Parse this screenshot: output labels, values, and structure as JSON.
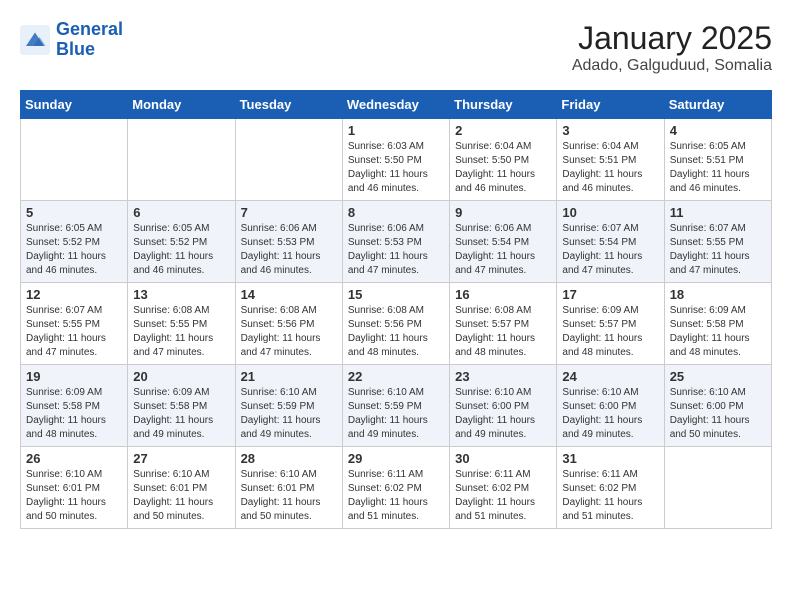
{
  "header": {
    "logo_line1": "General",
    "logo_line2": "Blue",
    "title": "January 2025",
    "subtitle": "Adado, Galguduud, Somalia"
  },
  "weekdays": [
    "Sunday",
    "Monday",
    "Tuesday",
    "Wednesday",
    "Thursday",
    "Friday",
    "Saturday"
  ],
  "weeks": [
    [
      {
        "day": "",
        "info": ""
      },
      {
        "day": "",
        "info": ""
      },
      {
        "day": "",
        "info": ""
      },
      {
        "day": "1",
        "info": "Sunrise: 6:03 AM\nSunset: 5:50 PM\nDaylight: 11 hours\nand 46 minutes."
      },
      {
        "day": "2",
        "info": "Sunrise: 6:04 AM\nSunset: 5:50 PM\nDaylight: 11 hours\nand 46 minutes."
      },
      {
        "day": "3",
        "info": "Sunrise: 6:04 AM\nSunset: 5:51 PM\nDaylight: 11 hours\nand 46 minutes."
      },
      {
        "day": "4",
        "info": "Sunrise: 6:05 AM\nSunset: 5:51 PM\nDaylight: 11 hours\nand 46 minutes."
      }
    ],
    [
      {
        "day": "5",
        "info": "Sunrise: 6:05 AM\nSunset: 5:52 PM\nDaylight: 11 hours\nand 46 minutes."
      },
      {
        "day": "6",
        "info": "Sunrise: 6:05 AM\nSunset: 5:52 PM\nDaylight: 11 hours\nand 46 minutes."
      },
      {
        "day": "7",
        "info": "Sunrise: 6:06 AM\nSunset: 5:53 PM\nDaylight: 11 hours\nand 46 minutes."
      },
      {
        "day": "8",
        "info": "Sunrise: 6:06 AM\nSunset: 5:53 PM\nDaylight: 11 hours\nand 47 minutes."
      },
      {
        "day": "9",
        "info": "Sunrise: 6:06 AM\nSunset: 5:54 PM\nDaylight: 11 hours\nand 47 minutes."
      },
      {
        "day": "10",
        "info": "Sunrise: 6:07 AM\nSunset: 5:54 PM\nDaylight: 11 hours\nand 47 minutes."
      },
      {
        "day": "11",
        "info": "Sunrise: 6:07 AM\nSunset: 5:55 PM\nDaylight: 11 hours\nand 47 minutes."
      }
    ],
    [
      {
        "day": "12",
        "info": "Sunrise: 6:07 AM\nSunset: 5:55 PM\nDaylight: 11 hours\nand 47 minutes."
      },
      {
        "day": "13",
        "info": "Sunrise: 6:08 AM\nSunset: 5:55 PM\nDaylight: 11 hours\nand 47 minutes."
      },
      {
        "day": "14",
        "info": "Sunrise: 6:08 AM\nSunset: 5:56 PM\nDaylight: 11 hours\nand 47 minutes."
      },
      {
        "day": "15",
        "info": "Sunrise: 6:08 AM\nSunset: 5:56 PM\nDaylight: 11 hours\nand 48 minutes."
      },
      {
        "day": "16",
        "info": "Sunrise: 6:08 AM\nSunset: 5:57 PM\nDaylight: 11 hours\nand 48 minutes."
      },
      {
        "day": "17",
        "info": "Sunrise: 6:09 AM\nSunset: 5:57 PM\nDaylight: 11 hours\nand 48 minutes."
      },
      {
        "day": "18",
        "info": "Sunrise: 6:09 AM\nSunset: 5:58 PM\nDaylight: 11 hours\nand 48 minutes."
      }
    ],
    [
      {
        "day": "19",
        "info": "Sunrise: 6:09 AM\nSunset: 5:58 PM\nDaylight: 11 hours\nand 48 minutes."
      },
      {
        "day": "20",
        "info": "Sunrise: 6:09 AM\nSunset: 5:58 PM\nDaylight: 11 hours\nand 49 minutes."
      },
      {
        "day": "21",
        "info": "Sunrise: 6:10 AM\nSunset: 5:59 PM\nDaylight: 11 hours\nand 49 minutes."
      },
      {
        "day": "22",
        "info": "Sunrise: 6:10 AM\nSunset: 5:59 PM\nDaylight: 11 hours\nand 49 minutes."
      },
      {
        "day": "23",
        "info": "Sunrise: 6:10 AM\nSunset: 6:00 PM\nDaylight: 11 hours\nand 49 minutes."
      },
      {
        "day": "24",
        "info": "Sunrise: 6:10 AM\nSunset: 6:00 PM\nDaylight: 11 hours\nand 49 minutes."
      },
      {
        "day": "25",
        "info": "Sunrise: 6:10 AM\nSunset: 6:00 PM\nDaylight: 11 hours\nand 50 minutes."
      }
    ],
    [
      {
        "day": "26",
        "info": "Sunrise: 6:10 AM\nSunset: 6:01 PM\nDaylight: 11 hours\nand 50 minutes."
      },
      {
        "day": "27",
        "info": "Sunrise: 6:10 AM\nSunset: 6:01 PM\nDaylight: 11 hours\nand 50 minutes."
      },
      {
        "day": "28",
        "info": "Sunrise: 6:10 AM\nSunset: 6:01 PM\nDaylight: 11 hours\nand 50 minutes."
      },
      {
        "day": "29",
        "info": "Sunrise: 6:11 AM\nSunset: 6:02 PM\nDaylight: 11 hours\nand 51 minutes."
      },
      {
        "day": "30",
        "info": "Sunrise: 6:11 AM\nSunset: 6:02 PM\nDaylight: 11 hours\nand 51 minutes."
      },
      {
        "day": "31",
        "info": "Sunrise: 6:11 AM\nSunset: 6:02 PM\nDaylight: 11 hours\nand 51 minutes."
      },
      {
        "day": "",
        "info": ""
      }
    ]
  ]
}
